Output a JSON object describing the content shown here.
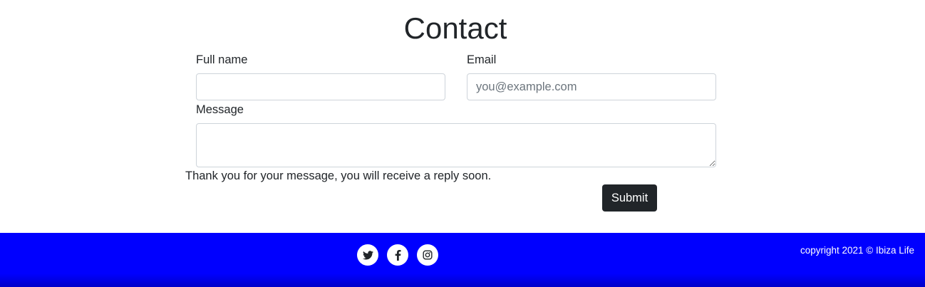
{
  "contact": {
    "title": "Contact",
    "full_name_label": "Full name",
    "full_name_value": "",
    "email_label": "Email",
    "email_placeholder": "you@example.com",
    "email_value": "",
    "message_label": "Message",
    "message_value": "",
    "confirmation": "Thank you for your message, you will receive a reply soon.",
    "submit_label": "Submit"
  },
  "footer": {
    "background_color": "#0000ff",
    "social": [
      {
        "icon": "twitter-icon"
      },
      {
        "icon": "facebook-icon"
      },
      {
        "icon": "instagram-icon"
      }
    ],
    "copyright": "copyright 2021 © Ibiza Life"
  }
}
